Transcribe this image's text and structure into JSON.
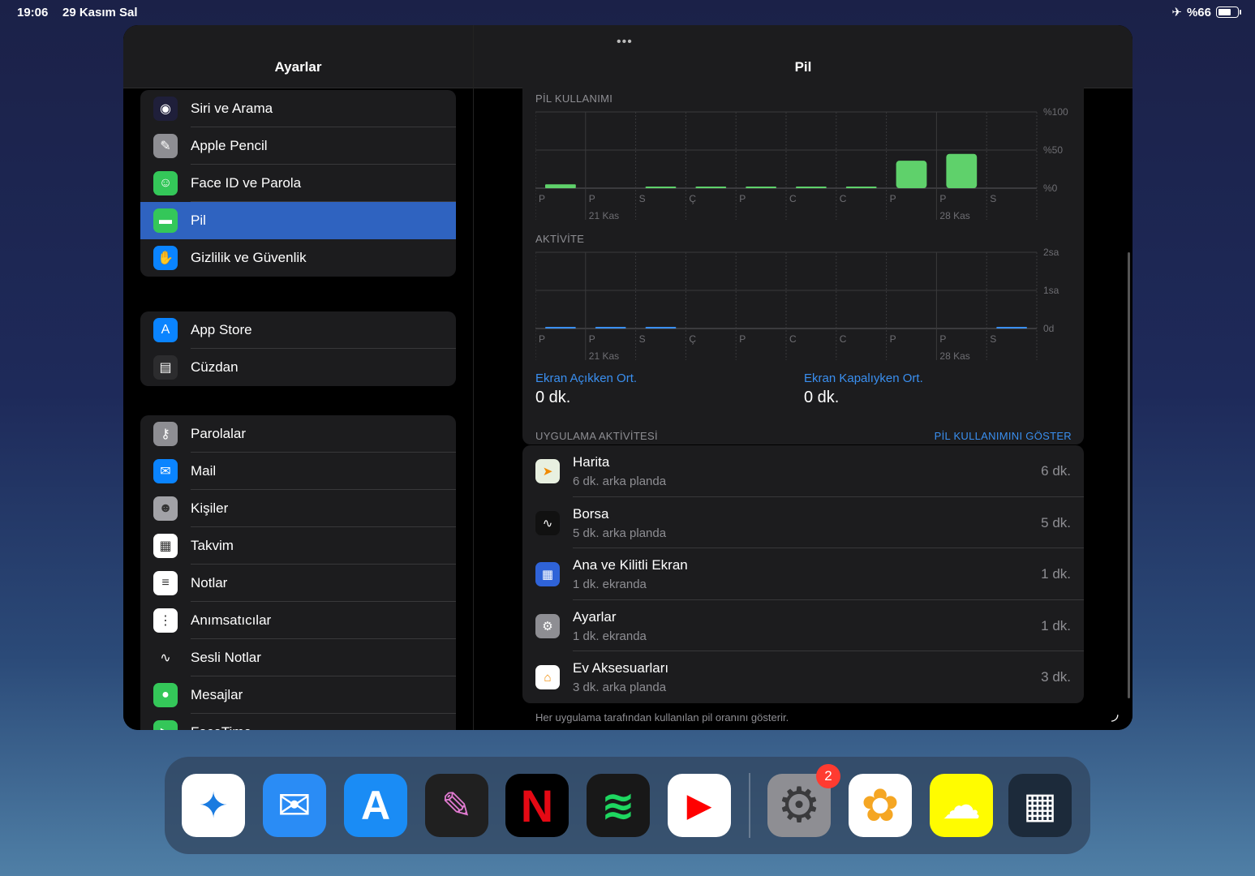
{
  "status_bar": {
    "time": "19:06",
    "date": "29 Kasım Sal",
    "battery_percent": "%66"
  },
  "sidebar": {
    "title": "Ayarlar",
    "group1": [
      {
        "label": "Siri ve Arama",
        "icon": "siri-icon",
        "color": "#1f1f3a"
      },
      {
        "label": "Apple Pencil",
        "icon": "pencil-icon",
        "color": "#8e8e93"
      },
      {
        "label": "Face ID ve Parola",
        "icon": "faceid-icon",
        "color": "#34c759"
      },
      {
        "label": "Pil",
        "icon": "battery-icon",
        "color": "#34c759",
        "selected": true
      },
      {
        "label": "Gizlilik ve Güvenlik",
        "icon": "hand-icon",
        "color": "#0a84ff"
      }
    ],
    "group2": [
      {
        "label": "App Store",
        "icon": "appstore-icon",
        "color": "#0a84ff"
      },
      {
        "label": "Cüzdan",
        "icon": "wallet-icon",
        "color": "#2c2c2e"
      }
    ],
    "group3": [
      {
        "label": "Parolalar",
        "icon": "key-icon",
        "color": "#8e8e93"
      },
      {
        "label": "Mail",
        "icon": "mail-icon",
        "color": "#0a84ff"
      },
      {
        "label": "Kişiler",
        "icon": "contacts-icon",
        "color": "#a2a2a7"
      },
      {
        "label": "Takvim",
        "icon": "calendar-icon",
        "color": "#ffffff"
      },
      {
        "label": "Notlar",
        "icon": "notes-icon",
        "color": "#ffffff"
      },
      {
        "label": "Anımsatıcılar",
        "icon": "reminders-icon",
        "color": "#ffffff"
      },
      {
        "label": "Sesli Notlar",
        "icon": "voice-memos-icon",
        "color": "#1c1c1e"
      },
      {
        "label": "Mesajlar",
        "icon": "messages-icon",
        "color": "#34c759"
      },
      {
        "label": "FaceTime",
        "icon": "facetime-icon",
        "color": "#34c759"
      }
    ]
  },
  "detail": {
    "title": "Pil",
    "battery_section_label": "PİL KULLANIMI",
    "activity_section_label": "AKTİVİTE",
    "screen_on_label": "Ekran Açıkken Ort.",
    "screen_on_value": "0 dk.",
    "screen_off_label": "Ekran Kapalıyken Ort.",
    "screen_off_value": "0 dk.",
    "app_activity_label": "UYGULAMA AKTİVİTESİ",
    "show_battery_usage": "PİL KULLANIMINI GÖSTER",
    "apps": [
      {
        "name": "Harita",
        "sub": "6 dk. arka planda",
        "value": "6 dk.",
        "icon": "maps-icon"
      },
      {
        "name": "Borsa",
        "sub": "5 dk. arka planda",
        "value": "5 dk.",
        "icon": "stocks-icon"
      },
      {
        "name": "Ana ve Kilitli Ekran",
        "sub": "1 dk. ekranda",
        "value": "1 dk.",
        "icon": "home-screen-icon"
      },
      {
        "name": "Ayarlar",
        "sub": "1 dk. ekranda",
        "value": "1 dk.",
        "icon": "settings-icon"
      },
      {
        "name": "Ev Aksesuarları",
        "sub": "3 dk. arka planda",
        "value": "3 dk.",
        "icon": "home-icon"
      }
    ],
    "footnote": "Her uygulama tarafından kullanılan pil oranını gösterir."
  },
  "chart_data": [
    {
      "type": "bar",
      "title": "PİL KULLANIMI",
      "categories": [
        "P",
        "P",
        "S",
        "Ç",
        "P",
        "C",
        "C",
        "P",
        "P",
        "S"
      ],
      "date_labels": [
        {
          "index": 1,
          "text": "21 Kas"
        },
        {
          "index": 8,
          "text": "28 Kas"
        }
      ],
      "y_tick_labels": [
        "%100",
        "%50",
        "%0"
      ],
      "ylim": [
        0,
        100
      ],
      "values": [
        5,
        0,
        2,
        2,
        2,
        2,
        2,
        36,
        45,
        0
      ],
      "color": "#5fd16b"
    },
    {
      "type": "bar",
      "title": "AKTİVİTE",
      "categories": [
        "P",
        "P",
        "S",
        "Ç",
        "P",
        "C",
        "C",
        "P",
        "P",
        "S"
      ],
      "date_labels": [
        {
          "index": 1,
          "text": "21 Kas"
        },
        {
          "index": 8,
          "text": "28 Kas"
        }
      ],
      "y_tick_labels": [
        "2sa",
        "1sa",
        "0d"
      ],
      "ylim": [
        0,
        120
      ],
      "values": [
        1,
        0.5,
        0.5,
        0,
        0,
        0,
        0,
        0,
        0,
        1
      ],
      "color": "#3a8ff0"
    }
  ],
  "dock": {
    "apps": [
      {
        "name": "Safari",
        "icon": "safari-icon",
        "color": "#ffffff"
      },
      {
        "name": "Mail",
        "icon": "mail-icon",
        "color": "#2a8cf5"
      },
      {
        "name": "App Store",
        "icon": "appstore-icon",
        "color": "#1a8cf5"
      },
      {
        "name": "Procreate",
        "icon": "procreate-icon",
        "color": "#202020"
      },
      {
        "name": "Netflix",
        "icon": "netflix-icon",
        "color": "#000000"
      },
      {
        "name": "Spotify",
        "icon": "spotify-icon",
        "color": "#181818"
      },
      {
        "name": "YouTube",
        "icon": "youtube-icon",
        "color": "#ffffff"
      },
      {
        "name": "Ayarlar",
        "icon": "settings-icon",
        "color": "#8e8e93",
        "badge": "2"
      },
      {
        "name": "Fotoğraflar",
        "icon": "photos-icon",
        "color": "#ffffff"
      },
      {
        "name": "Snapchat",
        "icon": "snapchat-icon",
        "color": "#fffc00"
      },
      {
        "name": "Son Kullanılanlar",
        "icon": "recent-apps-icon",
        "color": "#1c2a3a"
      }
    ]
  }
}
